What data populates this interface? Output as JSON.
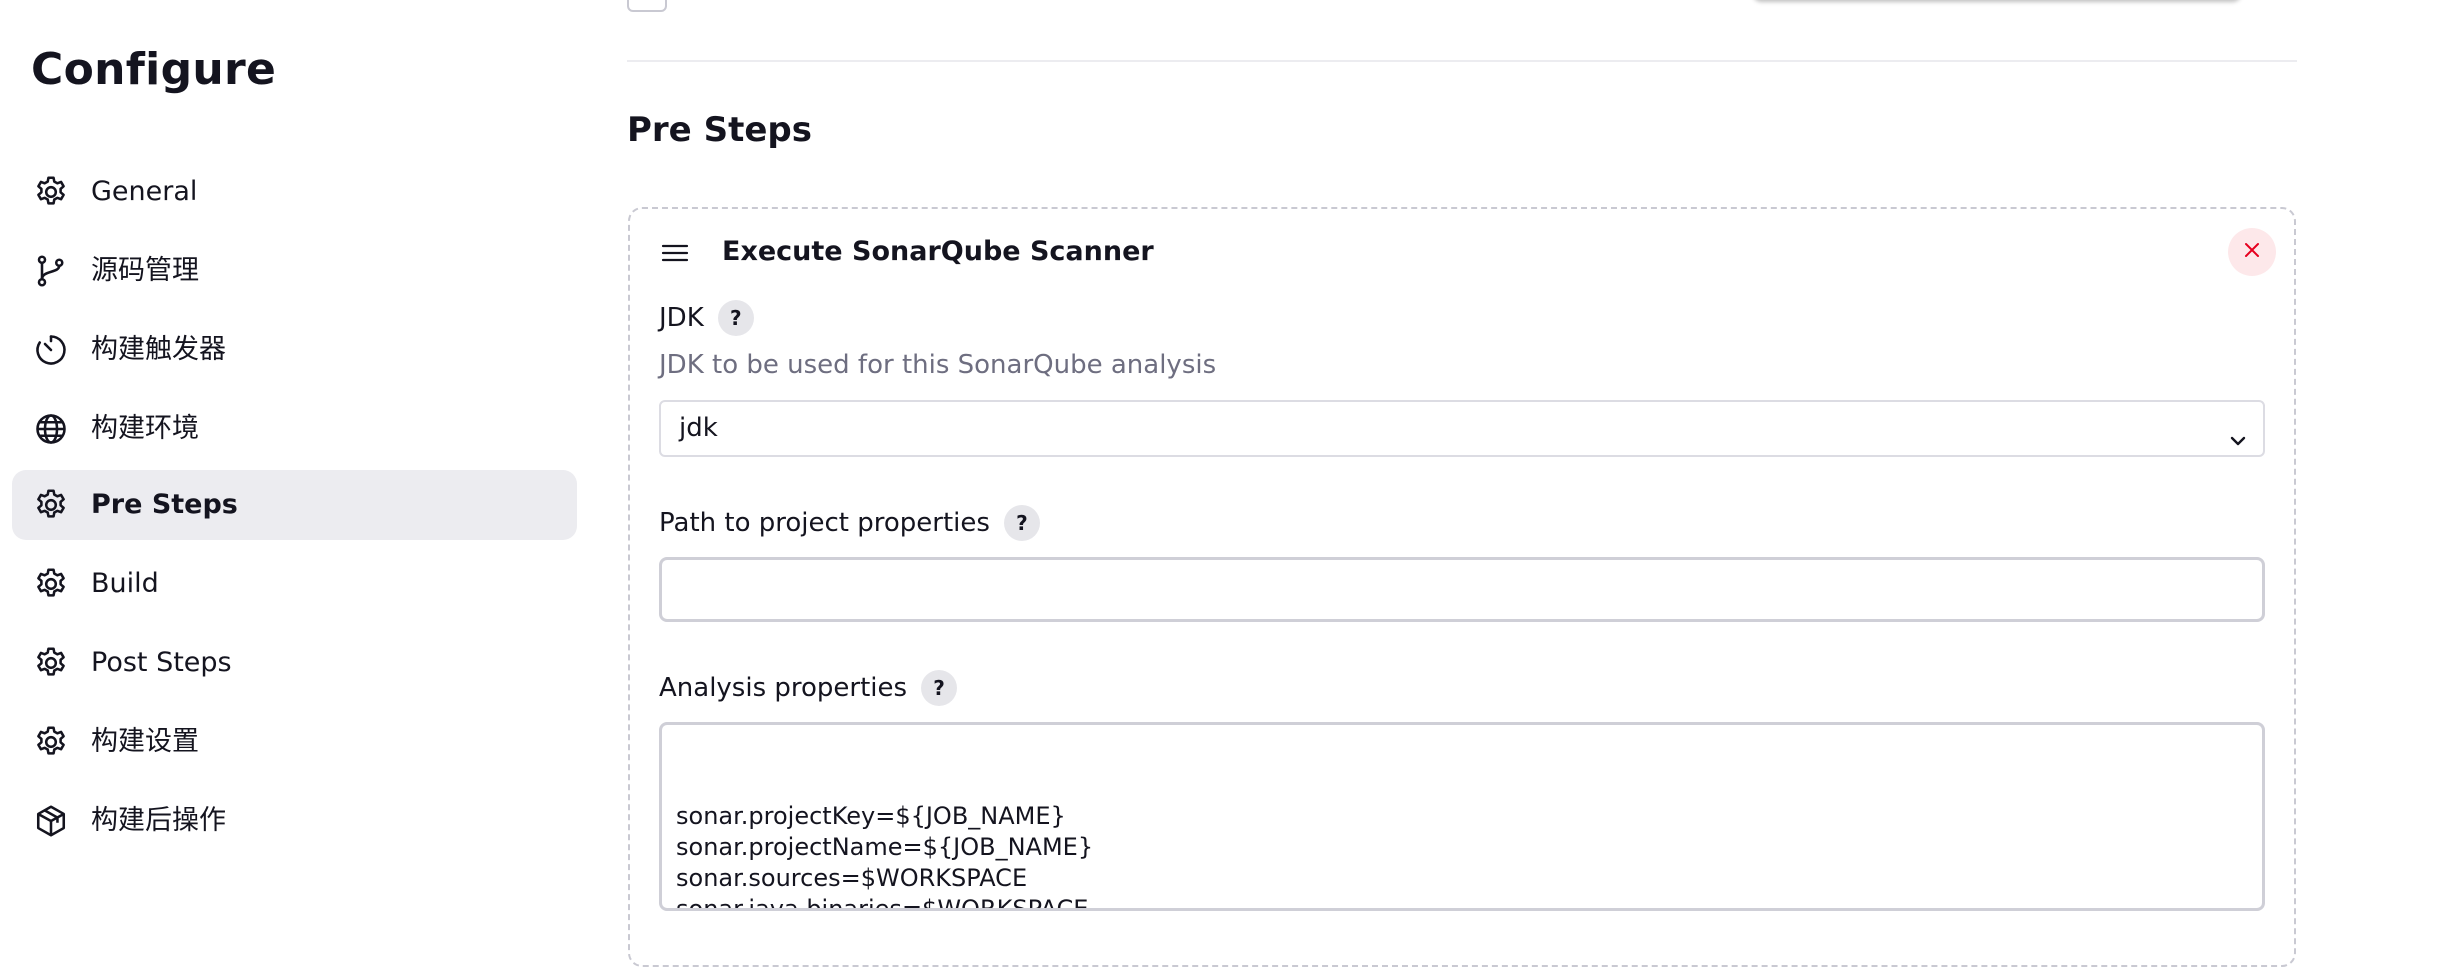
{
  "sidebar": {
    "title": "Configure",
    "items": [
      {
        "label": "General",
        "icon": "gear-icon",
        "active": false
      },
      {
        "label": "源码管理",
        "icon": "branch-icon",
        "active": false
      },
      {
        "label": "构建触发器",
        "icon": "timer-icon",
        "active": false
      },
      {
        "label": "构建环境",
        "icon": "globe-icon",
        "active": false
      },
      {
        "label": "Pre Steps",
        "icon": "gear-icon",
        "active": true
      },
      {
        "label": "Build",
        "icon": "gear-icon",
        "active": false
      },
      {
        "label": "Post Steps",
        "icon": "gear-icon",
        "active": false
      },
      {
        "label": "构建设置",
        "icon": "gear-icon",
        "active": false
      },
      {
        "label": "构建后操作",
        "icon": "package-icon",
        "active": false
      }
    ]
  },
  "main": {
    "section_title": "Pre Steps",
    "step": {
      "title": "Execute SonarQube Scanner",
      "jdk": {
        "label": "JDK",
        "help": "?",
        "description": "JDK to be used for this SonarQube analysis",
        "selected": "jdk"
      },
      "project_properties": {
        "label": "Path to project properties",
        "help": "?",
        "value": ""
      },
      "analysis_properties": {
        "label": "Analysis properties",
        "help": "?",
        "value": "sonar.projectKey=${JOB_NAME}\nsonar.projectName=${JOB_NAME}\nsonar.sources=$WORKSPACE\nsonar.java.binaries=$WORKSPACE"
      }
    }
  },
  "colors": {
    "text": "#14141f",
    "muted": "#6e6e80",
    "active_bg": "#ececf0",
    "close_bg": "#fde8ea",
    "close_x": "#e6001f"
  }
}
